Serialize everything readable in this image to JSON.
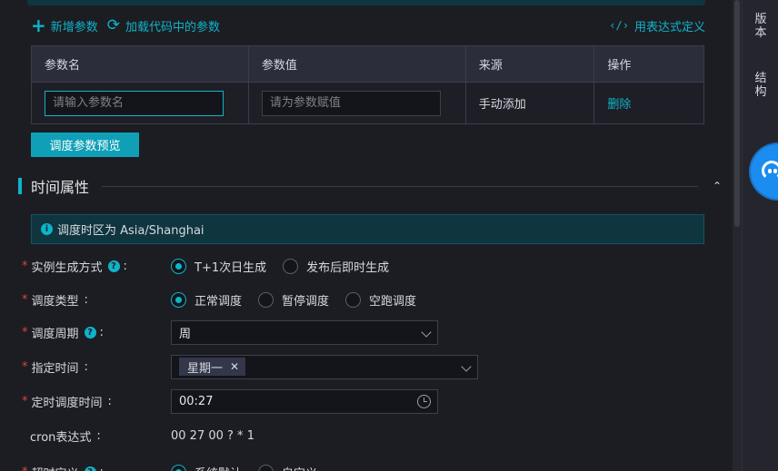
{
  "top_actions": {
    "add_param": "新增参数",
    "load_code_params": "加载代码中的参数",
    "use_expression": "用表达式定义"
  },
  "params_table": {
    "headers": [
      "参数名",
      "参数值",
      "来源",
      "操作"
    ],
    "rows": [
      {
        "name_placeholder": "请输入参数名",
        "value_placeholder": "请为参数赋值",
        "source": "手动添加",
        "action": "删除"
      }
    ]
  },
  "preview_button": "调度参数预览",
  "time_section": {
    "title": "时间属性",
    "timezone_notice": "调度时区为 Asia/Shanghai",
    "instance_gen": {
      "label": "实例生成方式",
      "options": [
        "T+1次日生成",
        "发布后即时生成"
      ],
      "selected": "T+1次日生成"
    },
    "schedule_type": {
      "label": "调度类型",
      "options": [
        "正常调度",
        "暂停调度",
        "空跑调度"
      ],
      "selected": "正常调度"
    },
    "schedule_cycle": {
      "label": "调度周期",
      "value": "周"
    },
    "specified_time": {
      "label": "指定时间",
      "tags": [
        "星期一"
      ]
    },
    "timed_schedule_time": {
      "label": "定时调度时间",
      "value": "00:27"
    },
    "cron": {
      "label": "cron表达式",
      "value": "00 27 00 ? * 1"
    },
    "timeout": {
      "label": "超时定义",
      "options": [
        "系统默认",
        "自定义"
      ],
      "selected": "系统默认"
    }
  },
  "right_panel": {
    "tabs": [
      "版本",
      "结构"
    ]
  },
  "colors": {
    "accent": "#0fb3c9",
    "required": "#e0453b",
    "background": "#1c1d22",
    "fab": "#1b8cf0"
  },
  "icons": [
    "plus-icon",
    "refresh-icon",
    "code-icon",
    "chevron-up-icon",
    "info-icon",
    "help-icon",
    "chevron-down-icon",
    "close-icon",
    "clock-icon",
    "assistant-icon"
  ]
}
